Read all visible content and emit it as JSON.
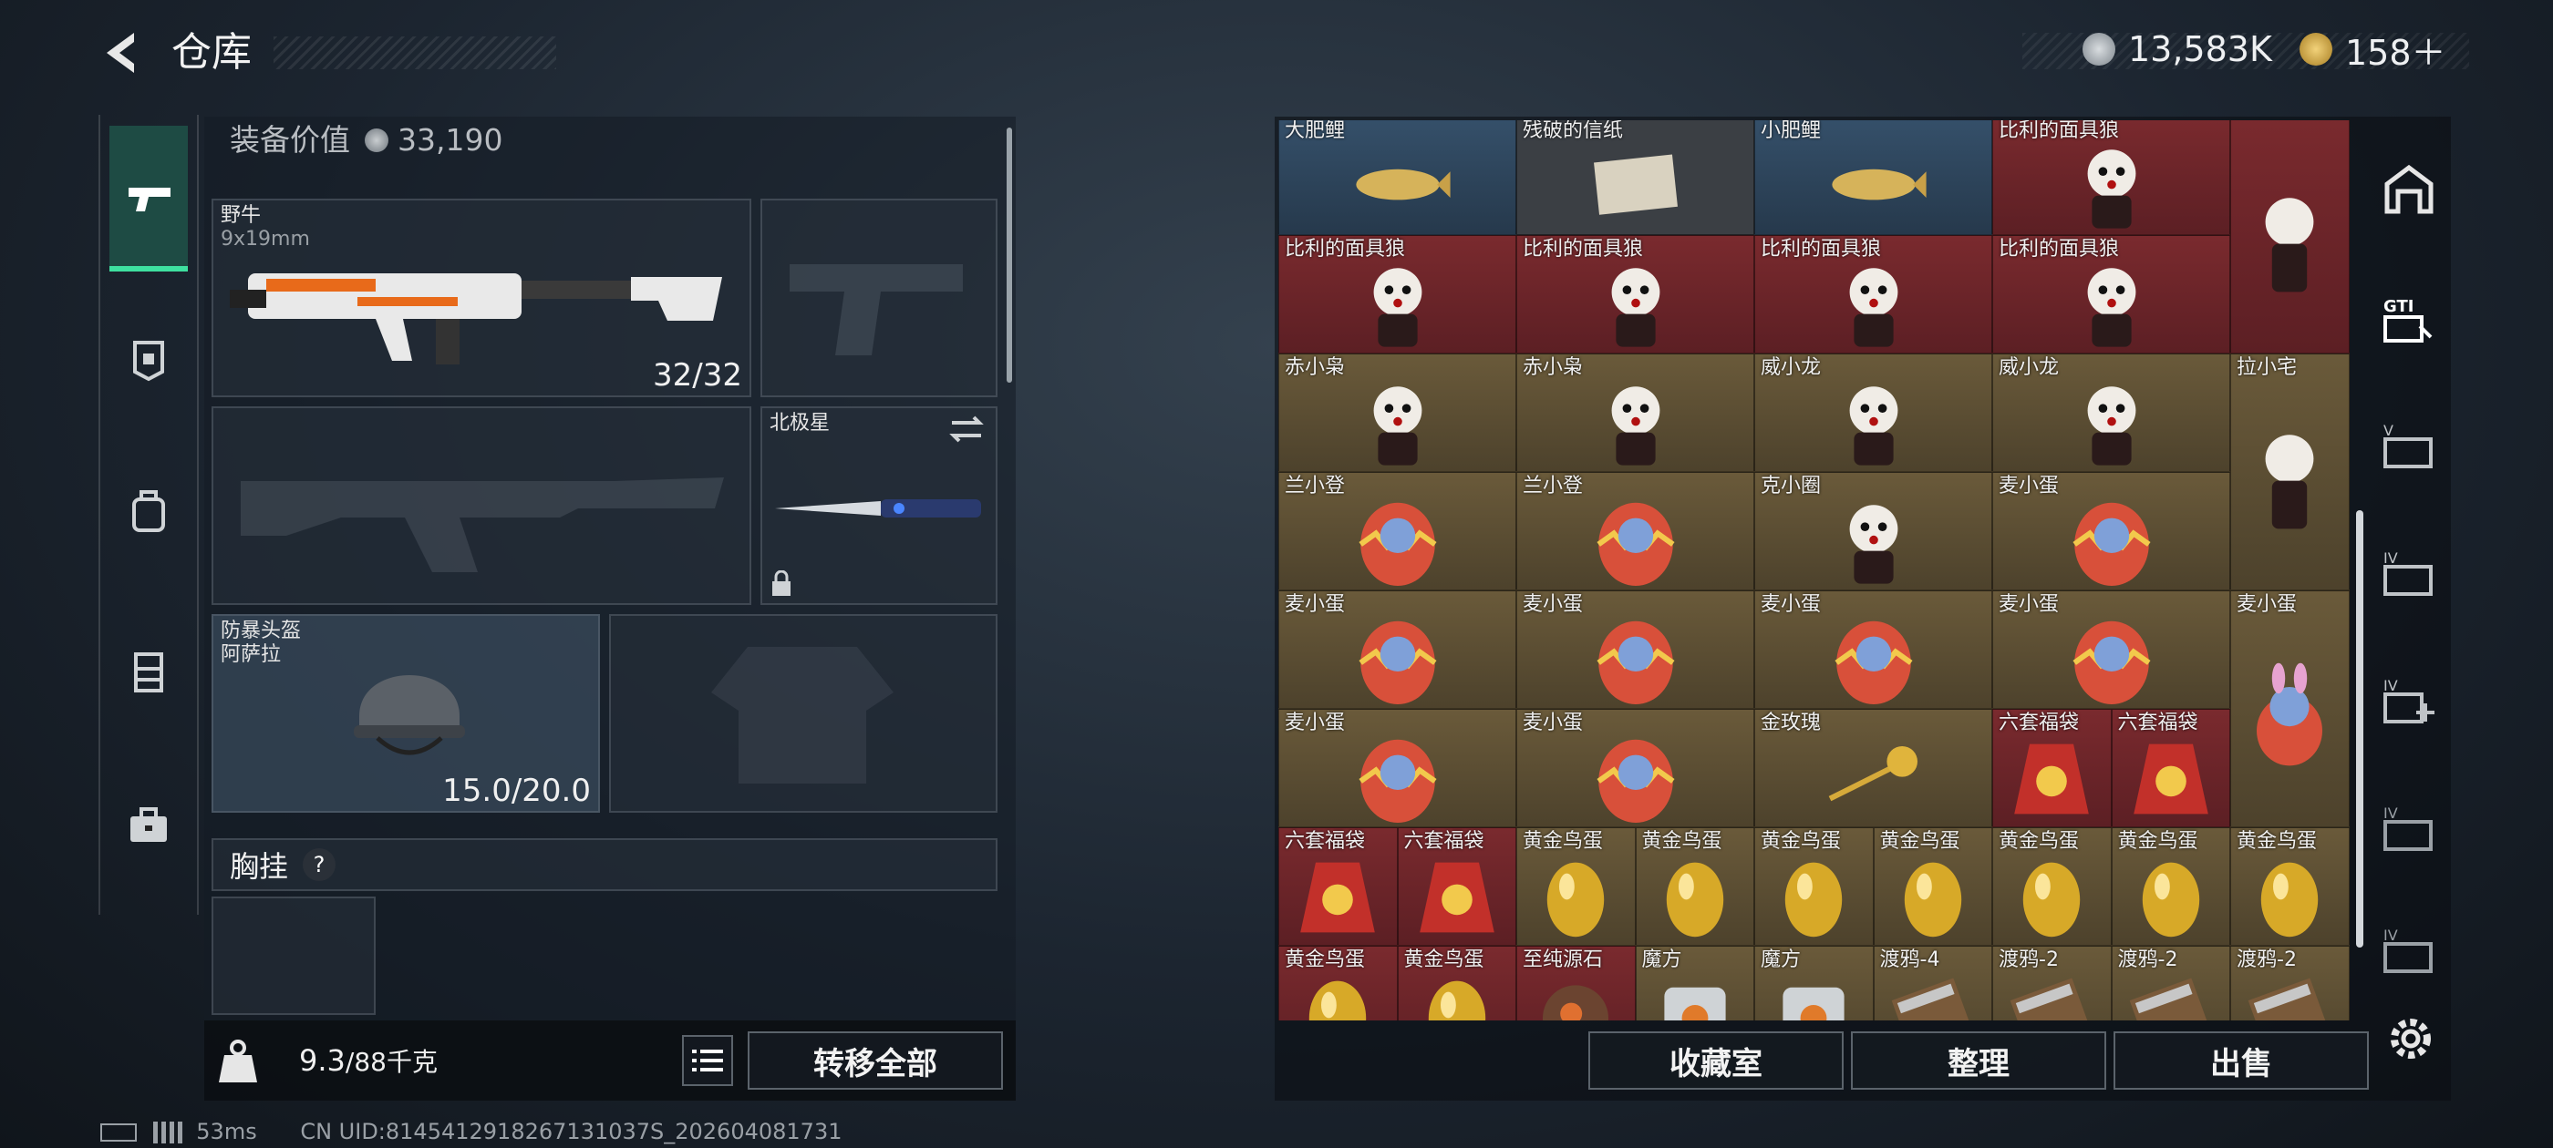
{
  "header": {
    "title": "仓库"
  },
  "currency": {
    "coins": "13,583K",
    "tickets": "158＋"
  },
  "left": {
    "equip_label": "装备价值",
    "equip_value": "33,190",
    "primary": {
      "name": "野牛",
      "ammo": "9x19mm",
      "count": "32/32"
    },
    "melee": {
      "name": "北极星"
    },
    "helmet": {
      "name": "防暴头盔",
      "sub": "阿萨拉",
      "durability": "15.0/20.0"
    },
    "chest": {
      "label": "胸挂",
      "help": "?"
    },
    "weight": {
      "value": "9.3",
      "max": "/88千克"
    },
    "transfer_all": "转移全部"
  },
  "items": [
    {
      "name": "大肥鲤",
      "color": "blue",
      "icon": "fish"
    },
    {
      "name": "残破的信纸",
      "color": "white",
      "icon": "paper"
    },
    {
      "name": "小肥鲤",
      "color": "blue",
      "icon": "fish"
    },
    {
      "name": "比利的面具狼",
      "color": "red",
      "icon": "doll"
    },
    {
      "name": "",
      "color": "red",
      "icon": "doll-tall"
    },
    {
      "name": "比利的面具狼",
      "color": "red",
      "icon": "doll"
    },
    {
      "name": "比利的面具狼",
      "color": "red",
      "icon": "doll"
    },
    {
      "name": "比利的面具狼",
      "color": "red",
      "icon": "doll"
    },
    {
      "name": "比利的面具狼",
      "color": "red",
      "icon": "doll"
    },
    {
      "name": "赤小枭",
      "color": "gold",
      "icon": "doll"
    },
    {
      "name": "赤小枭",
      "color": "gold",
      "icon": "doll"
    },
    {
      "name": "威小龙",
      "color": "gold",
      "icon": "doll"
    },
    {
      "name": "威小龙",
      "color": "gold",
      "icon": "doll"
    },
    {
      "name": "拉小宅",
      "color": "gold",
      "icon": "doll-tall"
    },
    {
      "name": "兰小登",
      "color": "gold",
      "icon": "egg"
    },
    {
      "name": "兰小登",
      "color": "gold",
      "icon": "egg"
    },
    {
      "name": "克小圈",
      "color": "gold",
      "icon": "doll"
    },
    {
      "name": "麦小蛋",
      "color": "gold",
      "icon": "egg"
    },
    {
      "name": "麦小蛋",
      "color": "gold",
      "icon": "egg"
    },
    {
      "name": "麦小蛋",
      "color": "gold",
      "icon": "egg"
    },
    {
      "name": "麦小蛋",
      "color": "gold",
      "icon": "egg"
    },
    {
      "name": "麦小蛋",
      "color": "gold",
      "icon": "egg"
    },
    {
      "name": "麦小蛋",
      "color": "gold",
      "icon": "egg-tall"
    },
    {
      "name": "麦小蛋",
      "color": "gold",
      "icon": "egg"
    },
    {
      "name": "麦小蛋",
      "color": "gold",
      "icon": "egg"
    },
    {
      "name": "金玫瑰",
      "color": "gold",
      "icon": "rose"
    },
    {
      "name": "六套福袋",
      "color": "red",
      "icon": "bag"
    },
    {
      "name": "六套福袋",
      "color": "red",
      "icon": "bag"
    },
    {
      "name": "六套福袋",
      "color": "red",
      "icon": "bag"
    },
    {
      "name": "六套福袋",
      "color": "red",
      "icon": "bag"
    },
    {
      "name": "黄金鸟蛋",
      "color": "gold",
      "icon": "goldegg"
    },
    {
      "name": "黄金鸟蛋",
      "color": "gold",
      "icon": "goldegg"
    },
    {
      "name": "黄金鸟蛋",
      "color": "gold",
      "icon": "goldegg"
    },
    {
      "name": "黄金鸟蛋",
      "color": "gold",
      "icon": "goldegg"
    },
    {
      "name": "黄金鸟蛋",
      "color": "gold",
      "icon": "goldegg"
    },
    {
      "name": "黄金鸟蛋",
      "color": "gold",
      "icon": "goldegg"
    },
    {
      "name": "黄金鸟蛋",
      "color": "gold",
      "icon": "goldegg"
    },
    {
      "name": "黄金鸟蛋",
      "color": "red",
      "icon": "goldegg"
    },
    {
      "name": "黄金鸟蛋",
      "color": "red",
      "icon": "goldegg"
    },
    {
      "name": "至纯源石",
      "color": "red",
      "icon": "stone"
    },
    {
      "name": "魔方",
      "color": "gold",
      "icon": "cube"
    },
    {
      "name": "魔方",
      "color": "gold",
      "icon": "cube"
    },
    {
      "name": "渡鸦-4",
      "color": "gold",
      "icon": "ammo"
    },
    {
      "name": "渡鸦-2",
      "color": "gold",
      "icon": "ammo"
    },
    {
      "name": "渡鸦-2",
      "color": "gold",
      "icon": "ammo"
    },
    {
      "name": "渡鸦-2",
      "color": "gold",
      "icon": "ammo"
    }
  ],
  "bottom": {
    "collection": "收藏室",
    "sort": "整理",
    "sell": "出售"
  },
  "status": {
    "ping": "53ms",
    "uid": "CN UID:8145412918267131037S_202604081731"
  },
  "colors": {
    "accent": "#3ee0a0",
    "red_cell": "#6b2428",
    "gold_cell": "#5c4e33",
    "blue_cell": "#2f4760"
  }
}
